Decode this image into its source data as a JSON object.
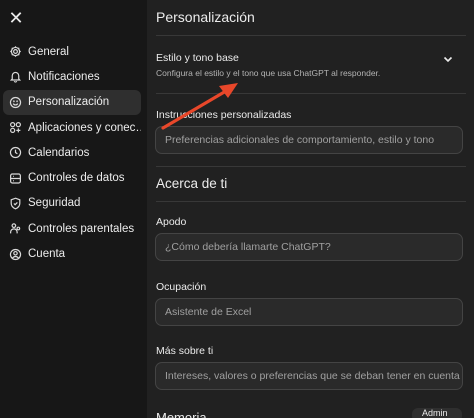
{
  "sidebar": {
    "items": [
      {
        "label": "General",
        "icon": "gear-icon"
      },
      {
        "label": "Notificaciones",
        "icon": "bell-icon"
      },
      {
        "label": "Personalización",
        "icon": "face-icon",
        "active": true
      },
      {
        "label": "Aplicaciones y conec…",
        "icon": "apps-icon"
      },
      {
        "label": "Calendarios",
        "icon": "clock-icon"
      },
      {
        "label": "Controles de datos",
        "icon": "database-icon"
      },
      {
        "label": "Seguridad",
        "icon": "shield-icon"
      },
      {
        "label": "Controles parentales",
        "icon": "parents-icon"
      },
      {
        "label": "Cuenta",
        "icon": "user-icon"
      }
    ]
  },
  "main": {
    "title": "Personalización",
    "style": {
      "label": "Estilo y tono base",
      "description": "Configura el estilo y el tono que usa ChatGPT al responder."
    },
    "custom_instructions": {
      "label": "Instrucciones personalizadas",
      "placeholder": "Preferencias adicionales de comportamiento, estilo y tono"
    },
    "about": {
      "title": "Acerca de ti",
      "nickname_label": "Apodo",
      "nickname_placeholder": "¿Cómo debería llamarte ChatGPT?",
      "occupation_label": "Ocupación",
      "occupation_value": "Asistente de Excel",
      "more_label": "Más sobre ti",
      "more_placeholder": "Intereses, valores o preferencias que se deban tener en cuenta"
    },
    "memory_title": "Memoria",
    "memory_button": "Admin"
  },
  "colors": {
    "sidebar_bg": "#171717",
    "main_bg": "#212121",
    "annotation_arrow": "#e8472a"
  }
}
